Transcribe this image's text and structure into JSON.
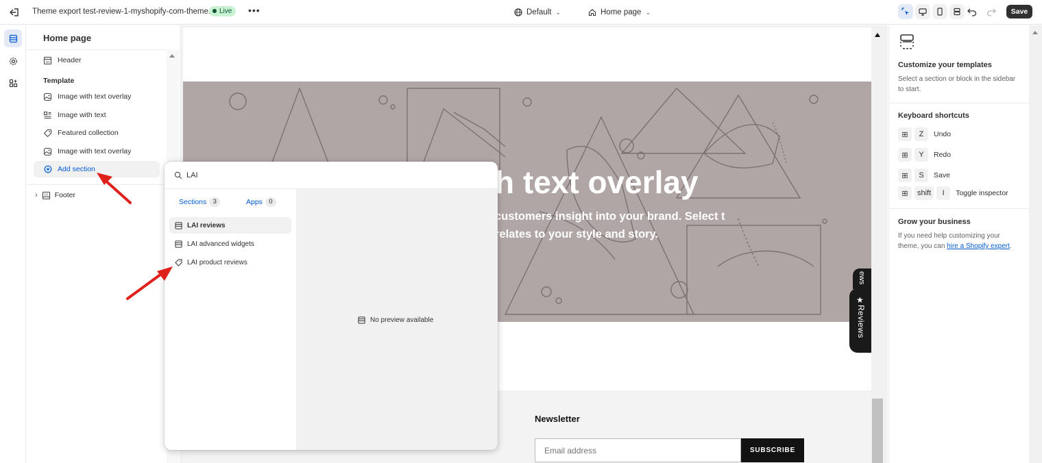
{
  "topbar": {
    "title": "Theme export test-review-1-myshopify-com-theme...",
    "live_badge": "Live",
    "more": "•••",
    "theme_selector": "Default",
    "page_selector": "Home page",
    "save_label": "Save"
  },
  "sidebar": {
    "title": "Home page",
    "header_item": "Header",
    "template_label": "Template",
    "items": [
      {
        "label": "Image with text overlay",
        "icon": "image-overlay-icon"
      },
      {
        "label": "Image with text",
        "icon": "image-text-icon"
      },
      {
        "label": "Featured collection",
        "icon": "tag-icon"
      },
      {
        "label": "Image with text overlay",
        "icon": "image-overlay-icon"
      }
    ],
    "add_section": "Add section",
    "footer_item": "Footer"
  },
  "preview": {
    "hero_title": "h text overlay",
    "hero_subtitle": "customers insight into your brand. Select t relates to your style and story.",
    "newsletter_title": "Newsletter",
    "email_placeholder": "Email address",
    "subscribe_label": "SUBSCRIBE",
    "reviews_tab": "Reviews",
    "reviews_tab_small": "ews"
  },
  "popover": {
    "search_value": "LAI",
    "tabs": [
      {
        "label": "Sections",
        "count": "3"
      },
      {
        "label": "Apps",
        "count": "0"
      }
    ],
    "results": [
      {
        "label": "LAI reviews",
        "icon": "section-icon"
      },
      {
        "label": "LAI advanced widgets",
        "icon": "section-icon"
      },
      {
        "label": "LAI product reviews",
        "icon": "tag-icon"
      }
    ],
    "no_preview": "No preview available"
  },
  "right_panel": {
    "heading": "Customize your templates",
    "desc": "Select a section or block in the sidebar to start.",
    "shortcuts_heading": "Keyboard shortcuts",
    "shortcuts": [
      {
        "keys": [
          "⊞",
          "Z"
        ],
        "label": "Undo"
      },
      {
        "keys": [
          "⊞",
          "Y"
        ],
        "label": "Redo"
      },
      {
        "keys": [
          "⊞",
          "S"
        ],
        "label": "Save"
      },
      {
        "keys": [
          "⊞",
          "shift",
          "I"
        ],
        "label": "Toggle inspector"
      }
    ],
    "grow_heading": "Grow your business",
    "grow_text_pre": "If you need help customizing your theme, you can ",
    "grow_link": "hire a Shopify expert",
    "grow_text_post": "."
  },
  "colors": {
    "accent": "#005bd3",
    "live_bg": "#c9f2d3",
    "hero_bg": "#b0a6a5",
    "arrow": "#e0201b"
  }
}
